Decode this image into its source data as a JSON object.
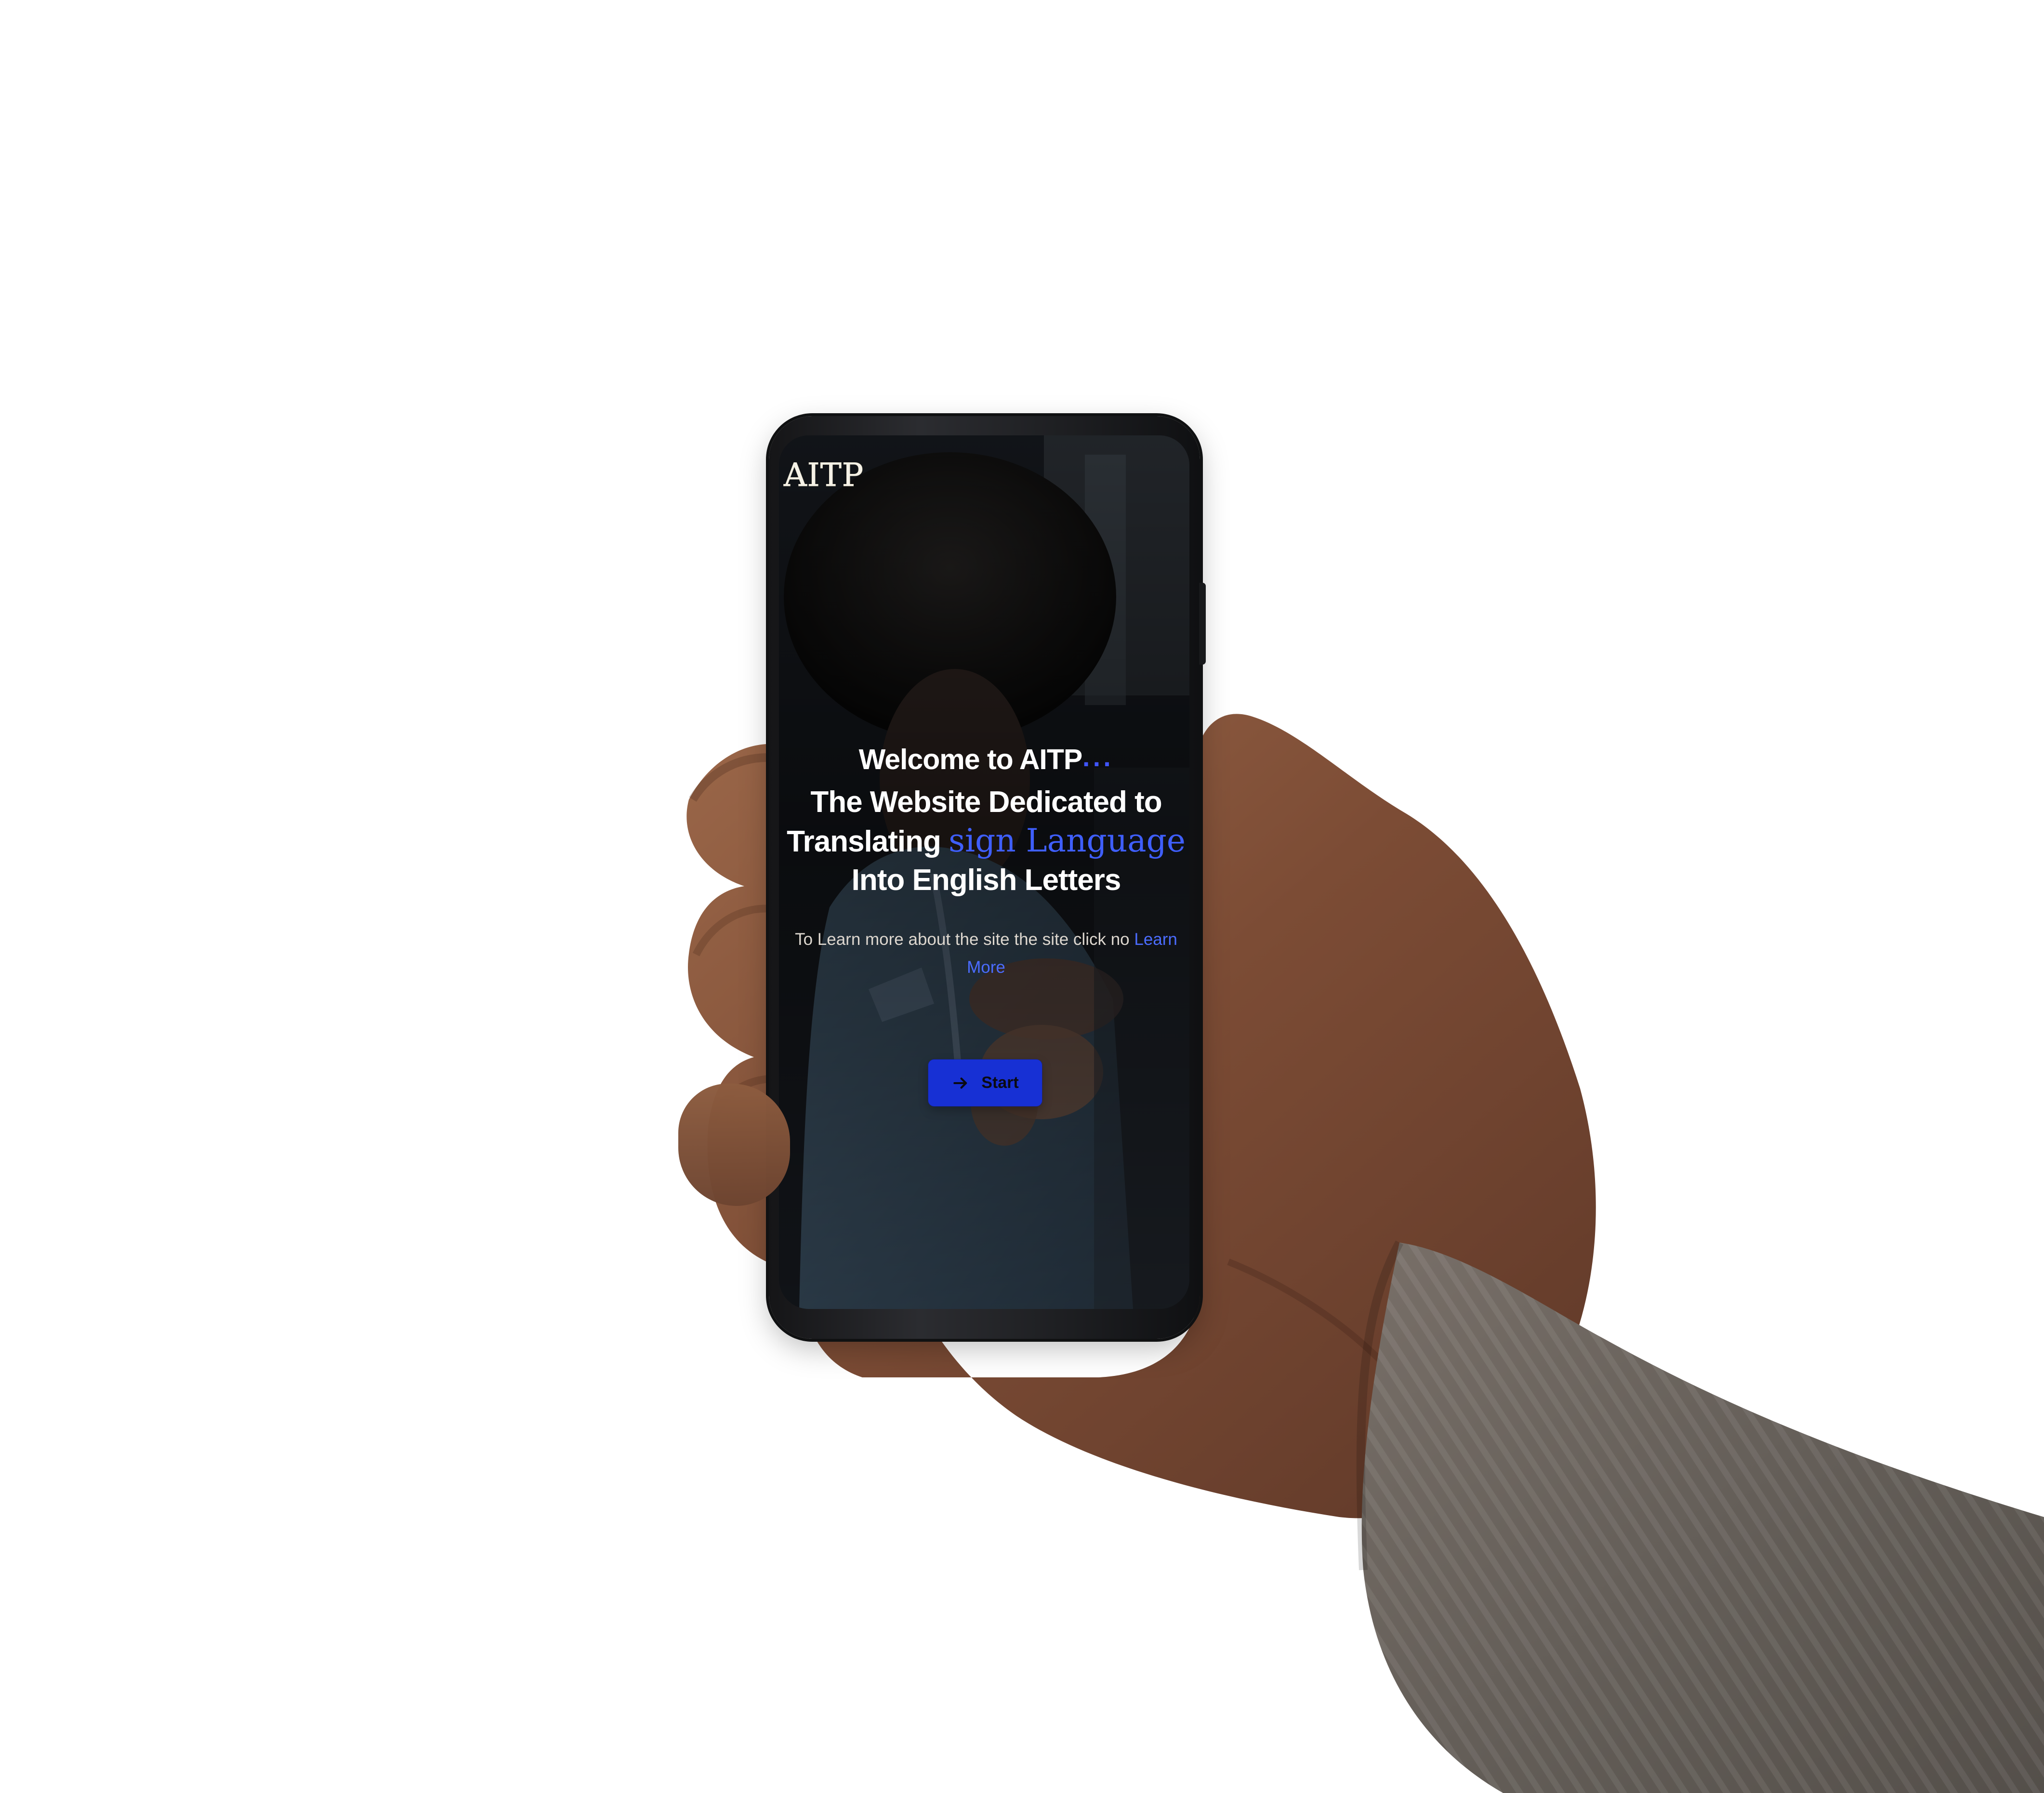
{
  "scene": {
    "background_color": "#ffffff",
    "hand_skin_color": "#7c4c35",
    "sleeve_color": "#655f59",
    "phone_frame_color": "#1b1c1f"
  },
  "app": {
    "logo_text": "AITP",
    "headline": {
      "line1_prefix": "Welcome to AITP",
      "line1_dots": "...",
      "line2": "The Website Dedicated to",
      "line3_prefix": "Translating ",
      "line3_accent": "sign Language",
      "line4": "Into English Letters"
    },
    "learn_more": {
      "text_prefix": "To Learn more about the site the site click no ",
      "link_text": "Learn More"
    },
    "start_button": {
      "label": "Start",
      "icon": "arrow-right-icon",
      "color": "#1730d4"
    },
    "accent_color": "#3f5fff"
  }
}
